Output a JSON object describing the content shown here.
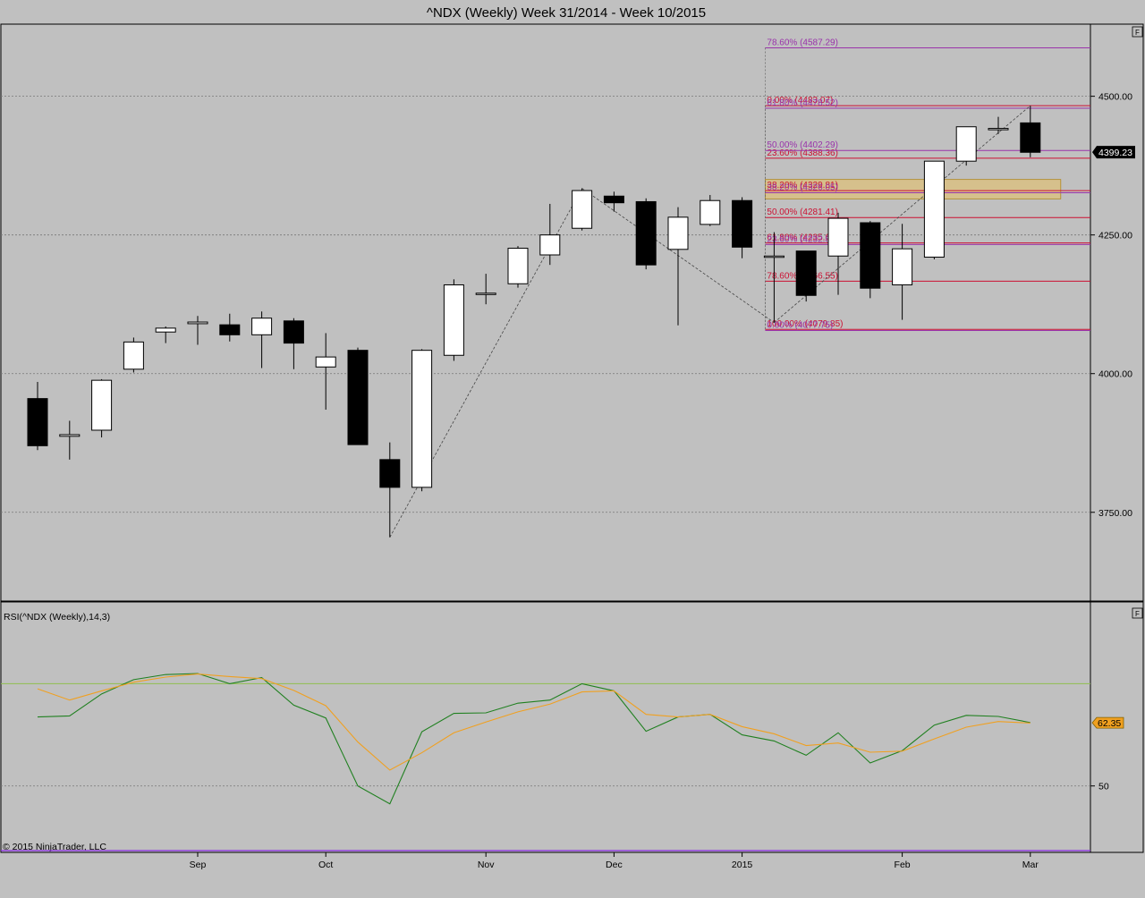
{
  "title": "^NDX (Weekly)  Week 31/2014 - Week 10/2015",
  "copyright": "© 2015 NinjaTrader, LLC",
  "panel_button_label": "F",
  "colors": {
    "background": "#c0c0c0",
    "up_candle": "#ffffff",
    "down_candle": "#000000",
    "fib_red": "#cc1133",
    "fib_purple": "#9933aa",
    "rsi_line": "#208020",
    "rsi_avg": "#f0a020",
    "rsi_level": "#8fbf4f",
    "zone_fill": "#e8c060"
  },
  "chart_data": [
    {
      "type": "candlestick",
      "title": "^NDX (Weekly)  Week 31/2014 - Week 10/2015",
      "ylim": [
        3590,
        4630
      ],
      "yticks": [
        3750,
        4000,
        4250,
        4500
      ],
      "ytick_labels": [
        "3750.00",
        "4000.00",
        "4250.00",
        "4500.00"
      ],
      "xtick_labels": [
        {
          "label": "Sep",
          "bar": 5
        },
        {
          "label": "Oct",
          "bar": 9
        },
        {
          "label": "Nov",
          "bar": 14
        },
        {
          "label": "Dec",
          "bar": 18
        },
        {
          "label": "2015",
          "bar": 22
        },
        {
          "label": "Feb",
          "bar": 27
        },
        {
          "label": "Mar",
          "bar": 31
        }
      ],
      "last_price": "4399.23",
      "grid": true,
      "candles": [
        {
          "o": 3955,
          "h": 3985,
          "l": 3862,
          "c": 3870
        },
        {
          "o": 3887,
          "h": 3915,
          "l": 3845,
          "c": 3890
        },
        {
          "o": 3898,
          "h": 3990,
          "l": 3885,
          "c": 3988
        },
        {
          "o": 4008,
          "h": 4065,
          "l": 4002,
          "c": 4057
        },
        {
          "o": 4075,
          "h": 4085,
          "l": 4055,
          "c": 4082
        },
        {
          "o": 4090,
          "h": 4104,
          "l": 4052,
          "c": 4093
        },
        {
          "o": 4088,
          "h": 4108,
          "l": 4058,
          "c": 4070
        },
        {
          "o": 4070,
          "h": 4112,
          "l": 4010,
          "c": 4100
        },
        {
          "o": 4095,
          "h": 4100,
          "l": 4008,
          "c": 4055
        },
        {
          "o": 4012,
          "h": 4073,
          "l": 3935,
          "c": 4030
        },
        {
          "o": 4042,
          "h": 4047,
          "l": 3872,
          "c": 3872
        },
        {
          "o": 3845,
          "h": 3876,
          "l": 3705,
          "c": 3795
        },
        {
          "o": 3795,
          "h": 4044,
          "l": 3788,
          "c": 4042
        },
        {
          "o": 4033,
          "h": 4170,
          "l": 4023,
          "c": 4160
        },
        {
          "o": 4145,
          "h": 4180,
          "l": 4125,
          "c": 4145
        },
        {
          "o": 4162,
          "h": 4230,
          "l": 4155,
          "c": 4226
        },
        {
          "o": 4214,
          "h": 4306,
          "l": 4196,
          "c": 4250
        },
        {
          "o": 4262,
          "h": 4334,
          "l": 4258,
          "c": 4330
        },
        {
          "o": 4320,
          "h": 4328,
          "l": 4292,
          "c": 4308
        },
        {
          "o": 4310,
          "h": 4316,
          "l": 4188,
          "c": 4196
        },
        {
          "o": 4224,
          "h": 4300,
          "l": 4087,
          "c": 4282
        },
        {
          "o": 4269,
          "h": 4322,
          "l": 4266,
          "c": 4312
        },
        {
          "o": 4312,
          "h": 4318,
          "l": 4208,
          "c": 4228
        },
        {
          "o": 4210,
          "h": 4255,
          "l": 4092,
          "c": 4212
        },
        {
          "o": 4221,
          "h": 4221,
          "l": 4130,
          "c": 4141
        },
        {
          "o": 4212,
          "h": 4290,
          "l": 4142,
          "c": 4280
        },
        {
          "o": 4272,
          "h": 4275,
          "l": 4136,
          "c": 4154
        },
        {
          "o": 4160,
          "h": 4270,
          "l": 4097,
          "c": 4225
        },
        {
          "o": 4210,
          "h": 4382,
          "l": 4206,
          "c": 4383
        },
        {
          "o": 4383,
          "h": 4445,
          "l": 4375,
          "c": 4445
        },
        {
          "o": 4440,
          "h": 4463,
          "l": 4432,
          "c": 4442
        },
        {
          "o": 4452,
          "h": 4483,
          "l": 4390,
          "c": 4399
        }
      ],
      "fib_retracements": [
        {
          "color": "red",
          "start_bar": 23,
          "levels": [
            {
              "label": "0.00% (4483.07)",
              "value": 4483.07
            },
            {
              "label": "23.60% (4388.36)",
              "value": 4388.36
            },
            {
              "label": "38.20% (4329.81)",
              "value": 4329.81
            },
            {
              "label": "50.00% (4281.41)",
              "value": 4281.41
            },
            {
              "label": "61.80% (4235.61)",
              "value": 4235.61
            },
            {
              "label": "78.60% (4166.55)",
              "value": 4166.55
            },
            {
              "label": "100.00% (4079.85)",
              "value": 4079.85
            }
          ]
        },
        {
          "color": "purple",
          "start_bar": 23,
          "levels": [
            {
              "label": "78.60% (4587.29)",
              "value": 4587.29
            },
            {
              "label": "61.80% (4478.52)",
              "value": 4478.52
            },
            {
              "label": "50.00% (4402.29)",
              "value": 4402.29
            },
            {
              "label": "38.20% (4326.05)",
              "value": 4326.05
            },
            {
              "label": "23.60% (4232.81)",
              "value": 4232.81
            },
            {
              "label": "0.00% (4077.75)",
              "value": 4077.75
            }
          ]
        }
      ],
      "zone": {
        "start_bar": 23,
        "end_bar": 31,
        "from": 4315,
        "to": 4350
      },
      "trendlines": [
        {
          "from_bar": 11,
          "from": 3705,
          "to_bar": 17,
          "to": 4334
        },
        {
          "from_bar": 17,
          "from": 4334,
          "to_bar": 23,
          "to": 4092
        },
        {
          "from_bar": 23,
          "from": 4092,
          "to_bar": 31,
          "to": 4483
        }
      ]
    },
    {
      "type": "line",
      "title": "RSI(^NDX (Weekly),14,3)",
      "ylim": [
        37,
        86
      ],
      "yticks": [
        50
      ],
      "ytick_labels": [
        "50"
      ],
      "level": 70,
      "last_value": "62.35",
      "series": [
        {
          "values": [
            63.5,
            63.7,
            68.0,
            70.8,
            71.8,
            72.0,
            70.0,
            71.2,
            65.8,
            63.3,
            50.0,
            46.5,
            60.6,
            64.2,
            64.3,
            66.2,
            66.8,
            70.0,
            68.6,
            60.7,
            63.5,
            64.0,
            60.0,
            58.8,
            56.0,
            60.4,
            54.5,
            56.9,
            61.9,
            63.8,
            63.6,
            62.4
          ]
        },
        {
          "values": [
            69.0,
            66.8,
            68.6,
            70.3,
            71.3,
            71.9,
            71.4,
            71.0,
            68.7,
            65.7,
            58.6,
            53.1,
            56.5,
            60.4,
            62.5,
            64.5,
            66.0,
            68.4,
            68.6,
            64.0,
            63.5,
            64.0,
            61.6,
            60.2,
            57.9,
            58.4,
            56.6,
            56.8,
            59.2,
            61.5,
            62.6,
            62.3
          ]
        }
      ]
    }
  ]
}
